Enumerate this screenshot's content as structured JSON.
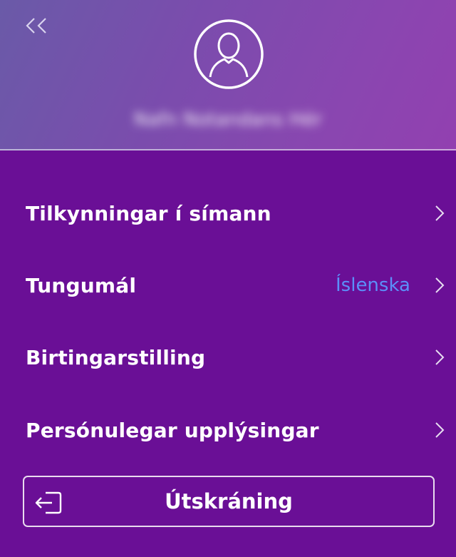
{
  "header": {
    "back_icon": "double-chevron-left-icon",
    "avatar_icon": "user-avatar-icon",
    "username": "Nafn Notandans Hér"
  },
  "menu": {
    "items": [
      {
        "label": "Tilkynningar í símann",
        "value": "",
        "icon": "chevron-right-icon"
      },
      {
        "label": "Tungumál",
        "value": "Íslenska",
        "icon": "chevron-right-icon"
      },
      {
        "label": "Birtingarstilling",
        "value": "",
        "icon": "chevron-right-icon"
      },
      {
        "label": "Persónulegar upplýsingar",
        "value": "",
        "icon": "chevron-right-icon"
      }
    ]
  },
  "logout": {
    "label": "Útskráning",
    "icon": "logout-icon"
  },
  "colors": {
    "background": "#6a0f96",
    "accent_value": "#5b8ff9",
    "text": "#ffffff"
  }
}
